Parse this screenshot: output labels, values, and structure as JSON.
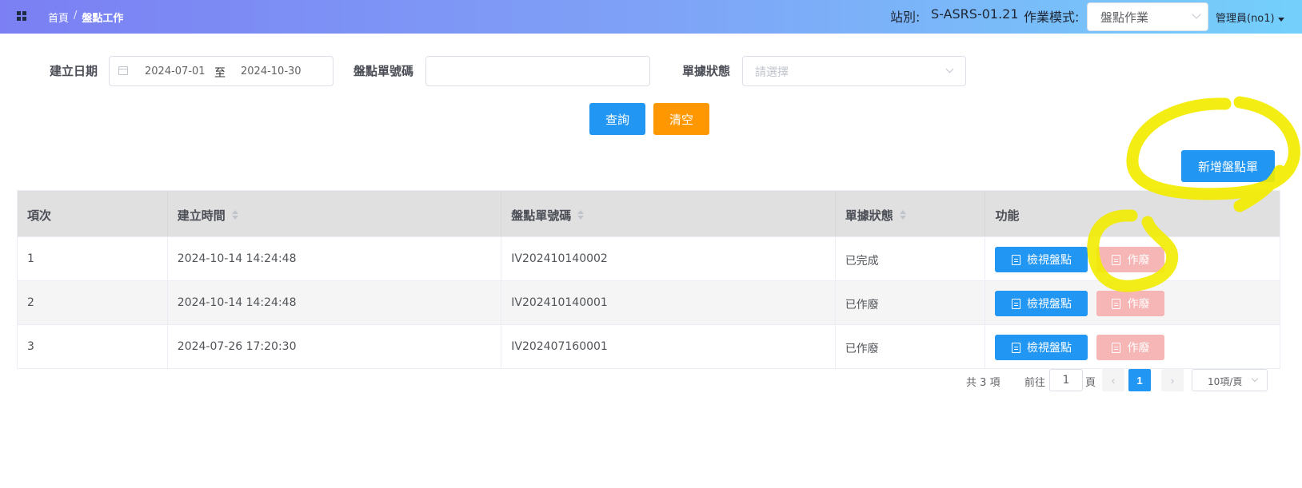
{
  "header": {
    "breadcrumb": [
      "首頁",
      "盤點工作"
    ],
    "breadcrumb_sep": "/",
    "station_label": "站別:",
    "station_value": "S-ASRS-01.21",
    "mode_label": "作業模式:",
    "mode_value": "盤點作業",
    "user": "管理員(no1)"
  },
  "filters": {
    "date_label": "建立日期",
    "date_start": "2024-07-01",
    "date_to": "至",
    "date_end": "2024-10-30",
    "order_no_label": "盤點單號碼",
    "order_no_value": "",
    "status_label": "單據狀態",
    "status_placeholder": "請選擇",
    "query_label": "查詢",
    "clear_label": "清空"
  },
  "actions": {
    "new_label": "新增盤點單"
  },
  "table": {
    "columns": [
      "項次",
      "建立時間",
      "盤點單號碼",
      "單據狀態",
      "功能"
    ],
    "rows": [
      {
        "index": "1",
        "created": "2024-10-14 14:24:48",
        "order_no": "IV202410140002",
        "status": "已完成"
      },
      {
        "index": "2",
        "created": "2024-10-14 14:24:48",
        "order_no": "IV202410140001",
        "status": "已作廢"
      },
      {
        "index": "3",
        "created": "2024-07-26 17:20:30",
        "order_no": "IV202407160001",
        "status": "已作廢"
      }
    ],
    "view_label": "檢視盤點",
    "void_label": "作廢"
  },
  "pagination": {
    "total": "共 3 項",
    "goto": "前往",
    "page_input": "1",
    "page_unit": "頁",
    "current_page": "1",
    "page_size": "10項/頁"
  },
  "colors": {
    "primary": "#2196f3",
    "warning": "#ff9800",
    "void": "#f7b6b6",
    "highlighter": "#f2ec00"
  }
}
